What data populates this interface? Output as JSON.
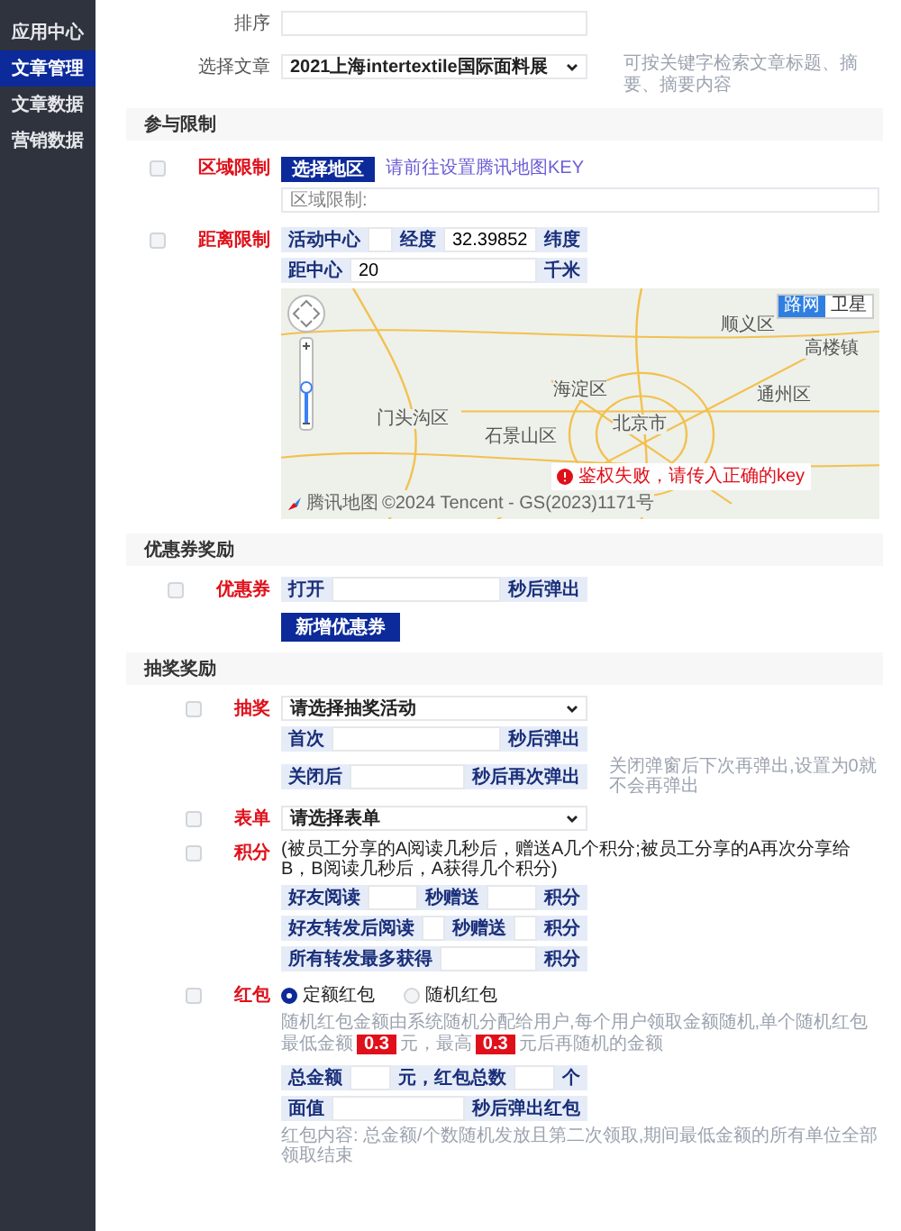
{
  "sidebar": {
    "items": [
      {
        "label": "应用中心",
        "selected": false
      },
      {
        "label": "文章管理",
        "selected": true
      },
      {
        "label": "文章数据",
        "selected": false
      },
      {
        "label": "营销数据",
        "selected": false
      }
    ]
  },
  "top_fields": [
    {
      "kind": "input",
      "label": "排序"
    },
    {
      "kind": "select",
      "label": "选择文章",
      "value": "2021上海intertextile国际面料展",
      "hint": "可按关键字检索文章标题、摘要、摘要内容"
    }
  ],
  "participation": {
    "title": "参与限制",
    "region": {
      "checked": false,
      "label": "区域限制",
      "button": "选择地区",
      "link": "请前往设置腾讯地图KEY",
      "placeholder": "区域限制:"
    },
    "distance": {
      "checked": false,
      "label": "距离限制",
      "center_addon": "活动中心",
      "lng_addon": "经度",
      "lat_value": "32.39852",
      "lat_addon": "纬度",
      "radius_addon": "距中心",
      "radius_value": "20",
      "unit": "千米"
    },
    "map": {
      "map_types": [
        {
          "label": "路网",
          "selected": true
        },
        {
          "label": "卫星",
          "selected": false
        }
      ],
      "places": [
        {
          "label": "顺义区"
        },
        {
          "label": "海淀区"
        },
        {
          "label": "门头沟区"
        },
        {
          "label": "石景山区"
        },
        {
          "label": "北京市"
        },
        {
          "label": "通州区"
        },
        {
          "label": "高楼镇"
        }
      ],
      "error": "鉴权失败，请传入正确的key",
      "logo": "腾讯地图",
      "attribution": "©2024 Tencent - GS(2023)1171号"
    }
  },
  "coupon": {
    "title": "优惠券奖励",
    "checked": false,
    "label": "优惠券",
    "prefix": "打开",
    "suffix": "秒后弹出",
    "add_button": "新增优惠券"
  },
  "lottery": {
    "title": "抽奖奖励",
    "draw": {
      "checked": false,
      "label": "抽奖",
      "select": "请选择抽奖活动",
      "first_prefix": "首次",
      "first_suffix": "秒后弹出",
      "close_prefix": "关闭后",
      "close_suffix": "秒后再次弹出",
      "hint": "关闭弹窗后下次再弹出,设置为0就不会再弹出"
    },
    "form": {
      "checked": false,
      "label": "表单",
      "select": "请选择表单"
    },
    "points": {
      "checked": false,
      "label": "积分",
      "note": "(被员工分享的A阅读几秒后，赠送A几个积分;被员工分享的A再次分享给B，B阅读几秒后，A获得几个积分)",
      "rows": [
        {
          "label": "好友阅读",
          "middle": "秒赠送",
          "unit": "积分"
        },
        {
          "label": "好友转发后阅读",
          "middle": "秒赠送",
          "unit": "积分"
        },
        {
          "label": "所有转发最多获得",
          "unit": "积分"
        }
      ]
    },
    "red_packet": {
      "checked": false,
      "label": "红包",
      "options": [
        {
          "label": "定额红包",
          "selected": true
        },
        {
          "label": "随机红包",
          "selected": false
        }
      ],
      "hint_parts": [
        {
          "kind": "text",
          "text": "随机红包金额由系统随机分配给用户,每个用户领取金额随机,单个随机红包最低金额"
        },
        {
          "kind": "badge",
          "text": "0.3"
        },
        {
          "kind": "text",
          "text": "元，最高"
        },
        {
          "kind": "badge",
          "text": "0.3"
        },
        {
          "kind": "text",
          "text": "元后再随机的金额"
        }
      ],
      "rows": [
        {
          "label": "总金额",
          "middle": "元，红包总数",
          "unit": "个"
        },
        {
          "label": "面值",
          "unit": "秒后弹出红包"
        }
      ],
      "footer": "红包内容: 总金额/个数随机发放且第二次领取,期间最低金额的所有单位全部领取结束"
    }
  }
}
